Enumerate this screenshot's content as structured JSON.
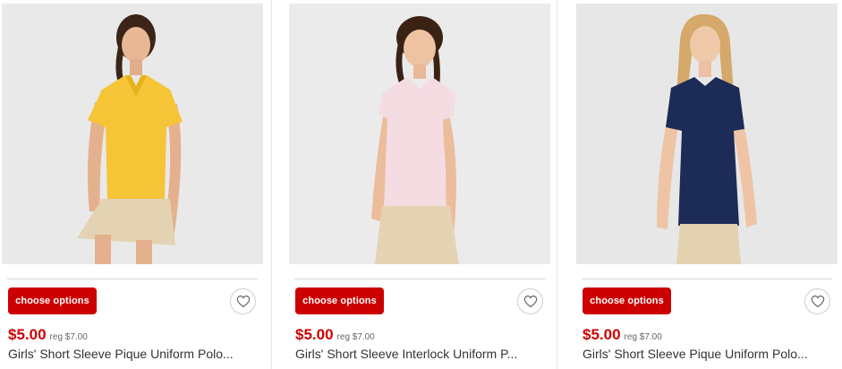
{
  "colors": {
    "accent": "#cc0000",
    "text": "#333333",
    "muted": "#666666"
  },
  "products": [
    {
      "image_alt": "Girl wearing a yellow short sleeve polo and khaki skort",
      "shirt_color": "#f6c437",
      "choose_label": "choose options",
      "favorite_icon": "heart-icon",
      "price": "$5.00",
      "reg_price": "reg $7.00",
      "title": "Girls' Short Sleeve Pique Uniform Polo..."
    },
    {
      "image_alt": "Girl wearing a light pink short sleeve polo and khaki skirt",
      "shirt_color": "#f5dbe2",
      "choose_label": "choose options",
      "favorite_icon": "heart-icon",
      "price": "$5.00",
      "reg_price": "reg $7.00",
      "title": "Girls' Short Sleeve Interlock Uniform P..."
    },
    {
      "image_alt": "Girl wearing a navy short sleeve polo and khaki pants",
      "shirt_color": "#1d2b57",
      "choose_label": "choose options",
      "favorite_icon": "heart-icon",
      "price": "$5.00",
      "reg_price": "reg $7.00",
      "title": "Girls' Short Sleeve Pique Uniform Polo..."
    }
  ]
}
